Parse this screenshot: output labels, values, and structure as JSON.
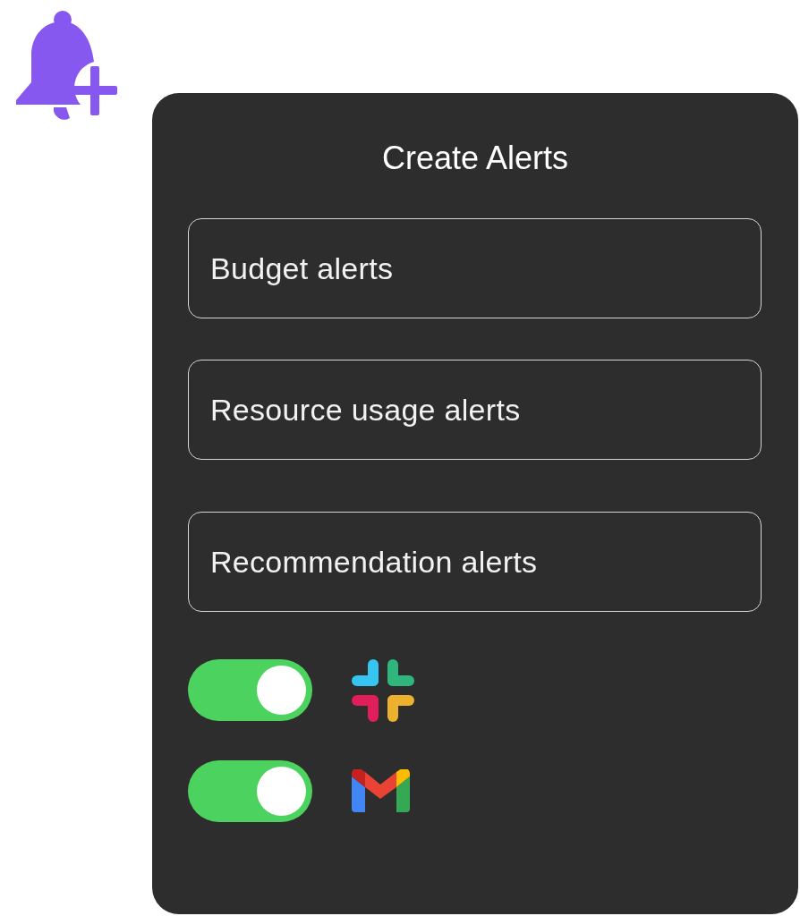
{
  "title": "Create Alerts",
  "options": [
    {
      "label": "Budget alerts"
    },
    {
      "label": "Resource usage alerts"
    },
    {
      "label": "Recommendation alerts"
    }
  ],
  "channels": [
    {
      "kind": "hash",
      "on": true
    },
    {
      "kind": "mail",
      "on": true
    }
  ]
}
